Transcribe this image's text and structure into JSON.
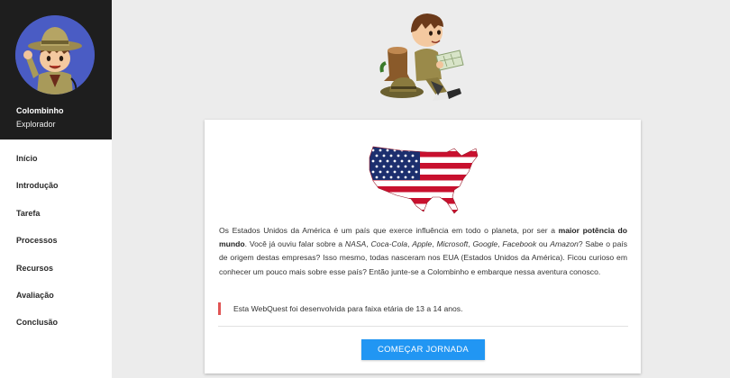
{
  "profile": {
    "name": "Colombinho",
    "role": "Explorador"
  },
  "nav": {
    "items": [
      {
        "label": "Início"
      },
      {
        "label": "Introdução"
      },
      {
        "label": "Tarefa"
      },
      {
        "label": "Processos"
      },
      {
        "label": "Recursos"
      },
      {
        "label": "Avaliação"
      },
      {
        "label": "Conclusão"
      }
    ]
  },
  "content": {
    "intro_part1": "Os Estados Unidos da América é um país que exerce influência em todo o planeta, por ser a ",
    "intro_bold": "maior potência do mundo",
    "intro_part2": ". Você já ouviu falar sobre a ",
    "brand_nasa": "NASA",
    "sep1": ", ",
    "brand_cocacola": "Coca-Cola",
    "sep2": ", ",
    "brand_apple": "Apple",
    "sep3": ", ",
    "brand_microsoft": "Microsoft",
    "sep4": ", ",
    "brand_google": "Google",
    "sep5": ", ",
    "brand_facebook": "Facebook",
    "sep6": " ou ",
    "brand_amazon": "Amazon",
    "intro_part3": "? Sabe o país de origem destas empresas? Isso mesmo, todas nasceram nos EUA (Estados Unidos da América). Ficou curioso em conhecer um pouco mais sobre esse país? Então junte-se a Colombinho e embarque nessa aventura conosco.",
    "note": "Esta WebQuest foi desenvolvida para faixa etária de 13 a 14 anos.",
    "cta_label": "COMEÇAR JORNADA"
  },
  "icons": {
    "avatar": "explorer-boy-avatar",
    "hero": "explorer-boy-reading-map-illustration",
    "map": "usa-flag-map"
  },
  "colors": {
    "sidebar_profile_bg": "#1e1e1e",
    "avatar_bg": "#4a5cc4",
    "accent_button": "#2196f3",
    "note_border": "#e05555",
    "page_bg": "#ececec"
  }
}
